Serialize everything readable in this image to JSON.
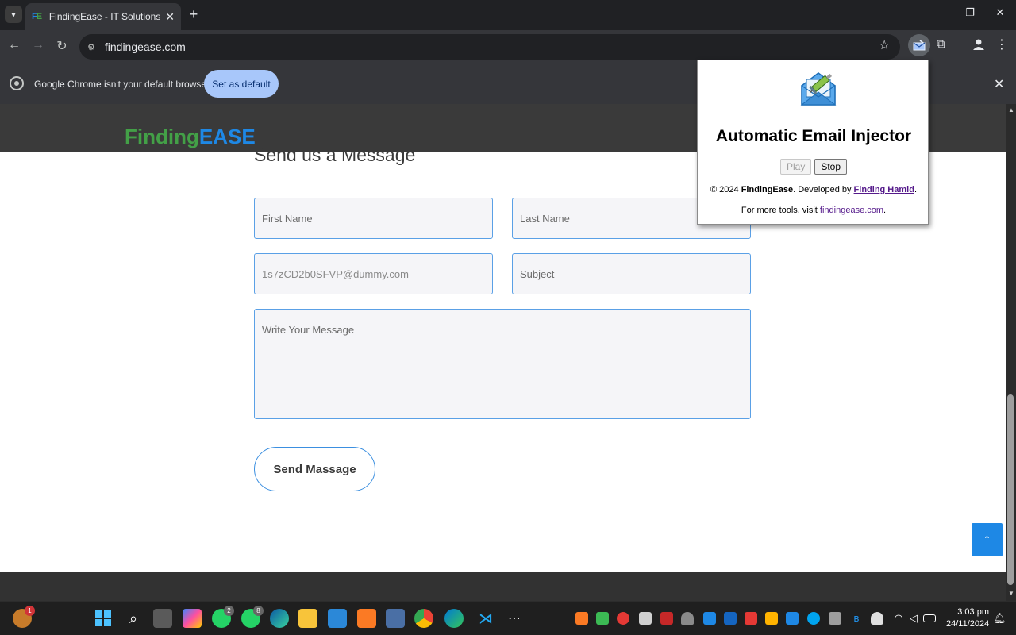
{
  "browser": {
    "tab_title": "FindingEase - IT Solutions & Ma",
    "tab_favicon": "FE",
    "new_tab_label": "+",
    "url": "findingease.com",
    "window_controls": {
      "minimize": "—",
      "restore": "❐",
      "close": "✕"
    }
  },
  "infobar": {
    "message": "Google Chrome isn't your default browser",
    "button_label": "Set as default"
  },
  "site": {
    "logo_part1": "Finding",
    "logo_part2": "EASE",
    "form_title": "Send us a Message",
    "fields": {
      "first_name": "First Name",
      "last_name": "Last Name",
      "email_value": "1s7zCD2b0SFVP@dummy.com",
      "subject": "Subject",
      "message": "Write Your Message"
    },
    "submit_label": "Send Massage",
    "scroll_top_icon": "arrow-up-icon"
  },
  "popup": {
    "title": "Automatic Email Injector",
    "play_label": "Play",
    "stop_label": "Stop",
    "copyright_prefix": "© 2024 ",
    "copyright_brand": "FindingEase",
    "copyright_middle": ". Developed by ",
    "developer_link": "Finding Hamid",
    "copyright_suffix": ".",
    "more_prefix": "For more tools, visit ",
    "more_link": "findingease.com",
    "more_suffix": ".",
    "icon": "email-syringe-icon"
  },
  "taskbar": {
    "whatsapp_badge_1": "2",
    "whatsapp_badge_2": "8",
    "weather_badge": "1",
    "time": "3:03 pm",
    "date": "24/11/2024"
  },
  "colors": {
    "accent": "#1e88e5",
    "field_border": "#5aa0e6",
    "logo_green": "#43a047",
    "chrome_dark": "#202124"
  }
}
